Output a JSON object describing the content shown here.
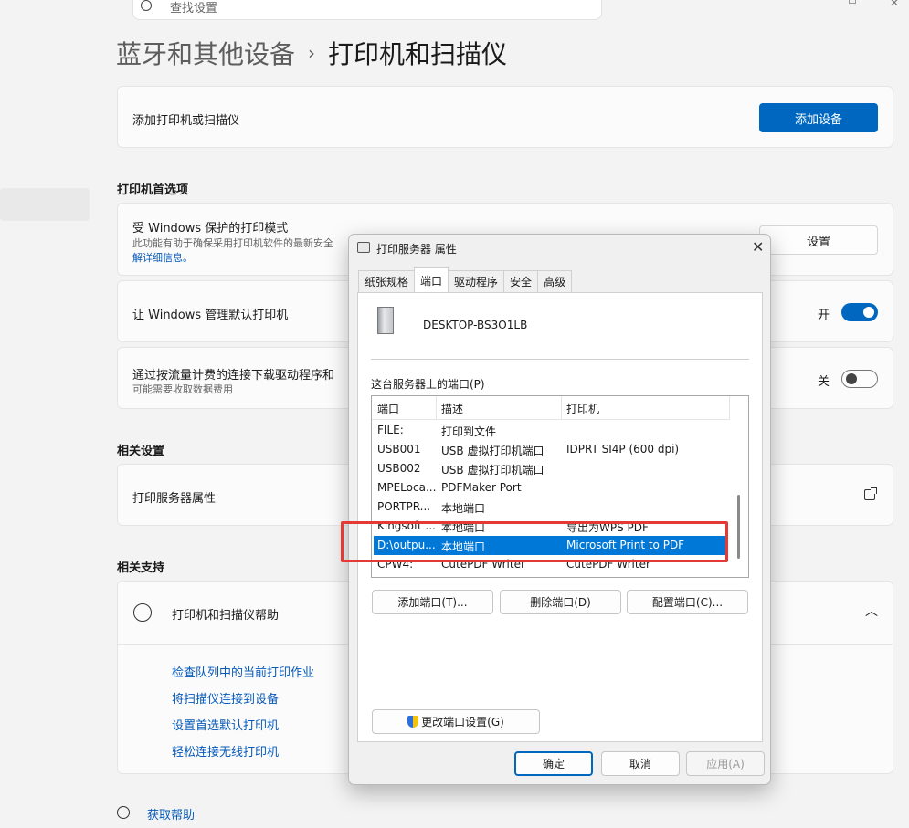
{
  "search": {
    "placeholder": "查找设置"
  },
  "breadcrumb": {
    "parent": "蓝牙和其他设备",
    "separator": "›",
    "current": "打印机和扫描仪"
  },
  "add_card": {
    "label": "添加打印机或扫描仪",
    "button": "添加设备"
  },
  "preferences": {
    "title": "打印机首选项",
    "protected_mode": {
      "label": "受 Windows 保护的打印模式",
      "sub": "此功能有助于确保采用打印机软件的最新安全",
      "link": "解详细信息。",
      "button": "设置"
    },
    "manage_default": {
      "label": "让 Windows 管理默认打印机",
      "state": "开"
    },
    "metered": {
      "label": "通过按流量计费的连接下载驱动程序和",
      "sub": "可能需要收取数据费用",
      "state": "关"
    }
  },
  "related_settings": {
    "title": "相关设置",
    "item": "打印服务器属性"
  },
  "related_support": {
    "title": "相关支持",
    "help_title": "打印机和扫描仪帮助",
    "links": [
      "检查队列中的当前打印作业",
      "将扫描仪连接到设备",
      "设置首选默认打印机",
      "轻松连接无线打印机"
    ]
  },
  "footer": {
    "get_help": "获取帮助"
  },
  "dialog": {
    "title": "打印服务器 属性",
    "tabs": [
      "纸张规格",
      "端口",
      "驱动程序",
      "安全",
      "高级"
    ],
    "active_tab": "端口",
    "host": "DESKTOP-BS3O1LB",
    "ports_label": "这台服务器上的端口(P)",
    "columns": [
      "端口",
      "描述",
      "打印机"
    ],
    "rows": [
      {
        "port": "FILE:",
        "desc": "打印到文件",
        "printer": ""
      },
      {
        "port": "USB001",
        "desc": "USB 虚拟打印机端口",
        "printer": "IDPRT SI4P (600 dpi)"
      },
      {
        "port": "USB002",
        "desc": "USB 虚拟打印机端口",
        "printer": ""
      },
      {
        "port": "MPELoca...",
        "desc": "PDFMaker Port",
        "printer": ""
      },
      {
        "port": "PORTPR...",
        "desc": "本地端口",
        "printer": ""
      },
      {
        "port": "Kingsoft ...",
        "desc": "本地端口",
        "printer": "导出为WPS PDF"
      },
      {
        "port": "D:\\outpu...",
        "desc": "本地端口",
        "printer": "Microsoft Print to PDF"
      },
      {
        "port": "CPW4:",
        "desc": "CutePDF Writer",
        "printer": "CutePDF Writer"
      }
    ],
    "selected_row": 6,
    "buttons": {
      "add_port": "添加端口(T)...",
      "delete_port": "删除端口(D)",
      "configure_port": "配置端口(C)...",
      "change_settings": "更改端口设置(G)"
    },
    "footer": {
      "ok": "确定",
      "cancel": "取消",
      "apply": "应用(A)"
    }
  },
  "colors": {
    "accent": "#0067c0",
    "selection": "#0078d7",
    "highlight": "#e53935"
  }
}
